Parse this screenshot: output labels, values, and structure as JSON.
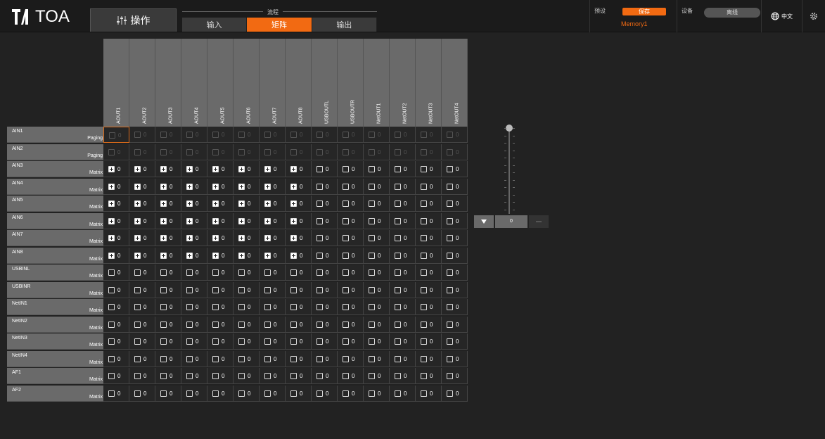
{
  "brand": {
    "name": "TOA"
  },
  "toolbar": {
    "ops_label": "操作"
  },
  "flow": {
    "title": "流程",
    "tabs": [
      {
        "label": "输入"
      },
      {
        "label": "矩阵",
        "active": true
      },
      {
        "label": "输出"
      }
    ]
  },
  "preset": {
    "label": "预设",
    "save_label": "保存",
    "memory": "Memory1"
  },
  "device": {
    "label": "设备",
    "status": "离线"
  },
  "language": {
    "label": "中文"
  },
  "columns": [
    "AOUT1",
    "AOUT2",
    "AOUT3",
    "AOUT4",
    "AOUT5",
    "AOUT6",
    "AOUT7",
    "AOUT8",
    "USBOUTL",
    "USBOUTR",
    "NetOUT1",
    "NetOUT2",
    "NetOUT3",
    "NetOUT4"
  ],
  "rows": [
    {
      "name": "AIN1",
      "mode": "Paging",
      "values": [
        0,
        0,
        0,
        0,
        0,
        0,
        0,
        0,
        0,
        0,
        0,
        0,
        0,
        0
      ],
      "on": [
        0,
        0,
        0,
        0,
        0,
        0,
        0,
        0,
        0,
        0,
        0,
        0,
        0,
        0
      ],
      "dim": true
    },
    {
      "name": "AIN2",
      "mode": "Paging",
      "values": [
        0,
        0,
        0,
        0,
        0,
        0,
        0,
        0,
        0,
        0,
        0,
        0,
        0,
        0
      ],
      "on": [
        0,
        0,
        0,
        0,
        0,
        0,
        0,
        0,
        0,
        0,
        0,
        0,
        0,
        0
      ],
      "dim": true
    },
    {
      "name": "AIN3",
      "mode": "Matrix",
      "values": [
        0,
        0,
        0,
        0,
        0,
        0,
        0,
        0,
        0,
        0,
        0,
        0,
        0,
        0
      ],
      "on": [
        1,
        1,
        1,
        1,
        1,
        1,
        1,
        1,
        0,
        0,
        0,
        0,
        0,
        0
      ]
    },
    {
      "name": "AIN4",
      "mode": "Matrix",
      "values": [
        0,
        0,
        0,
        0,
        0,
        0,
        0,
        0,
        0,
        0,
        0,
        0,
        0,
        0
      ],
      "on": [
        1,
        1,
        1,
        1,
        1,
        1,
        1,
        1,
        0,
        0,
        0,
        0,
        0,
        0
      ]
    },
    {
      "name": "AIN5",
      "mode": "Matrix",
      "values": [
        0,
        0,
        0,
        0,
        0,
        0,
        0,
        0,
        0,
        0,
        0,
        0,
        0,
        0
      ],
      "on": [
        1,
        1,
        1,
        1,
        1,
        1,
        1,
        1,
        0,
        0,
        0,
        0,
        0,
        0
      ]
    },
    {
      "name": "AIN6",
      "mode": "Matrix",
      "values": [
        0,
        0,
        0,
        0,
        0,
        0,
        0,
        0,
        0,
        0,
        0,
        0,
        0,
        0
      ],
      "on": [
        1,
        1,
        1,
        1,
        1,
        1,
        1,
        1,
        0,
        0,
        0,
        0,
        0,
        0
      ]
    },
    {
      "name": "AIN7",
      "mode": "Matrix",
      "values": [
        0,
        0,
        0,
        0,
        0,
        0,
        0,
        0,
        0,
        0,
        0,
        0,
        0,
        0
      ],
      "on": [
        1,
        1,
        1,
        1,
        1,
        1,
        1,
        1,
        0,
        0,
        0,
        0,
        0,
        0
      ]
    },
    {
      "name": "AIN8",
      "mode": "Matrix",
      "values": [
        0,
        0,
        0,
        0,
        0,
        0,
        0,
        0,
        0,
        0,
        0,
        0,
        0,
        0
      ],
      "on": [
        1,
        1,
        1,
        1,
        1,
        1,
        1,
        1,
        0,
        0,
        0,
        0,
        0,
        0
      ]
    },
    {
      "name": "USBINL",
      "mode": "Matrix",
      "values": [
        0,
        0,
        0,
        0,
        0,
        0,
        0,
        0,
        0,
        0,
        0,
        0,
        0,
        0
      ],
      "on": [
        0,
        0,
        0,
        0,
        0,
        0,
        0,
        0,
        0,
        0,
        0,
        0,
        0,
        0
      ]
    },
    {
      "name": "USBINR",
      "mode": "Matrix",
      "values": [
        0,
        0,
        0,
        0,
        0,
        0,
        0,
        0,
        0,
        0,
        0,
        0,
        0,
        0
      ],
      "on": [
        0,
        0,
        0,
        0,
        0,
        0,
        0,
        0,
        0,
        0,
        0,
        0,
        0,
        0
      ]
    },
    {
      "name": "NetIN1",
      "mode": "Matrix",
      "values": [
        0,
        0,
        0,
        0,
        0,
        0,
        0,
        0,
        0,
        0,
        0,
        0,
        0,
        0
      ],
      "on": [
        0,
        0,
        0,
        0,
        0,
        0,
        0,
        0,
        0,
        0,
        0,
        0,
        0,
        0
      ]
    },
    {
      "name": "NetIN2",
      "mode": "Matrix",
      "values": [
        0,
        0,
        0,
        0,
        0,
        0,
        0,
        0,
        0,
        0,
        0,
        0,
        0,
        0
      ],
      "on": [
        0,
        0,
        0,
        0,
        0,
        0,
        0,
        0,
        0,
        0,
        0,
        0,
        0,
        0
      ]
    },
    {
      "name": "NetIN3",
      "mode": "Matrix",
      "values": [
        0,
        0,
        0,
        0,
        0,
        0,
        0,
        0,
        0,
        0,
        0,
        0,
        0,
        0
      ],
      "on": [
        0,
        0,
        0,
        0,
        0,
        0,
        0,
        0,
        0,
        0,
        0,
        0,
        0,
        0
      ]
    },
    {
      "name": "NetIN4",
      "mode": "Matrix",
      "values": [
        0,
        0,
        0,
        0,
        0,
        0,
        0,
        0,
        0,
        0,
        0,
        0,
        0,
        0
      ],
      "on": [
        0,
        0,
        0,
        0,
        0,
        0,
        0,
        0,
        0,
        0,
        0,
        0,
        0,
        0
      ]
    },
    {
      "name": "AF1",
      "mode": "Matrix",
      "values": [
        0,
        0,
        0,
        0,
        0,
        0,
        0,
        0,
        0,
        0,
        0,
        0,
        0,
        0
      ],
      "on": [
        0,
        0,
        0,
        0,
        0,
        0,
        0,
        0,
        0,
        0,
        0,
        0,
        0,
        0
      ]
    },
    {
      "name": "AF2",
      "mode": "Matrix",
      "values": [
        0,
        0,
        0,
        0,
        0,
        0,
        0,
        0,
        0,
        0,
        0,
        0,
        0,
        0
      ],
      "on": [
        0,
        0,
        0,
        0,
        0,
        0,
        0,
        0,
        0,
        0,
        0,
        0,
        0,
        0
      ]
    }
  ],
  "fader": {
    "value": "0",
    "level": 1.0
  },
  "colors": {
    "accent": "#f26a12",
    "panel": "#6a6a6a"
  }
}
